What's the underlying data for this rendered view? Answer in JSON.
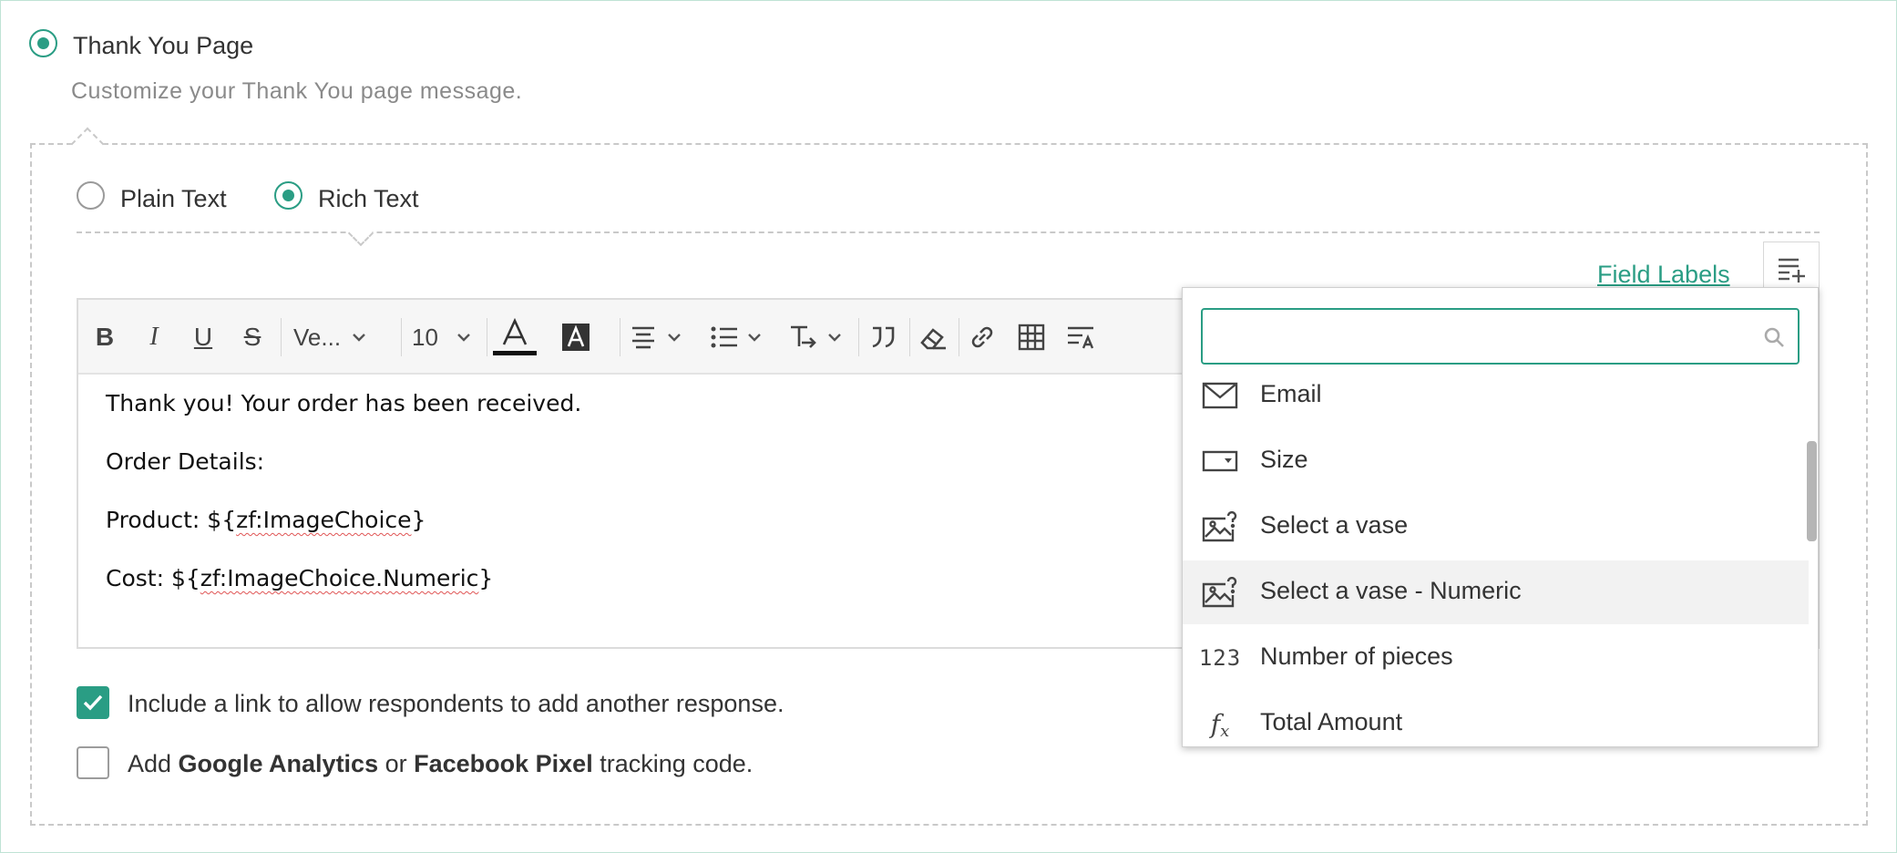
{
  "header": {
    "option_label": "Thank You Page",
    "description": "Customize your Thank You page message."
  },
  "format": {
    "plain_label": "Plain Text",
    "rich_label": "Rich Text",
    "selected": "Rich Text"
  },
  "field_labels_link": "Field Labels",
  "toolbar": {
    "bold": "B",
    "italic": "I",
    "underline": "U",
    "strike": "S",
    "font_family": "Ve...",
    "font_size": "10"
  },
  "editor": {
    "line1": "Thank you! Your order has been received.",
    "line2": "Order Details:",
    "line3_prefix": "Product: ${",
    "line3_token": "zf:ImageChoice",
    "line3_suffix": "}",
    "line4_prefix": "Cost: ${",
    "line4_token": "zf:ImageChoice.Numeric",
    "line4_suffix": "}"
  },
  "options": {
    "include_link_label": "Include a link to allow respondents to add another response.",
    "include_link_checked": true,
    "tracking_prefix": "Add ",
    "tracking_ga": "Google Analytics",
    "tracking_or": " or ",
    "tracking_fb": "Facebook Pixel",
    "tracking_suffix": " tracking code.",
    "tracking_checked": false
  },
  "dropdown": {
    "search_value": "",
    "items": [
      {
        "label": "Email",
        "icon": "email-icon"
      },
      {
        "label": "Size",
        "icon": "dropdown-field-icon"
      },
      {
        "label": "Select a vase",
        "icon": "image-choice-icon"
      },
      {
        "label": "Select a vase - Numeric",
        "icon": "image-choice-icon",
        "highlighted": true
      },
      {
        "label": "Number of pieces",
        "icon": "number-icon"
      },
      {
        "label": "Total Amount",
        "icon": "formula-icon"
      }
    ]
  },
  "colors": {
    "accent": "#2a9d84",
    "highlight_row": "#f2f2f2",
    "border": "#c9c9c9"
  }
}
